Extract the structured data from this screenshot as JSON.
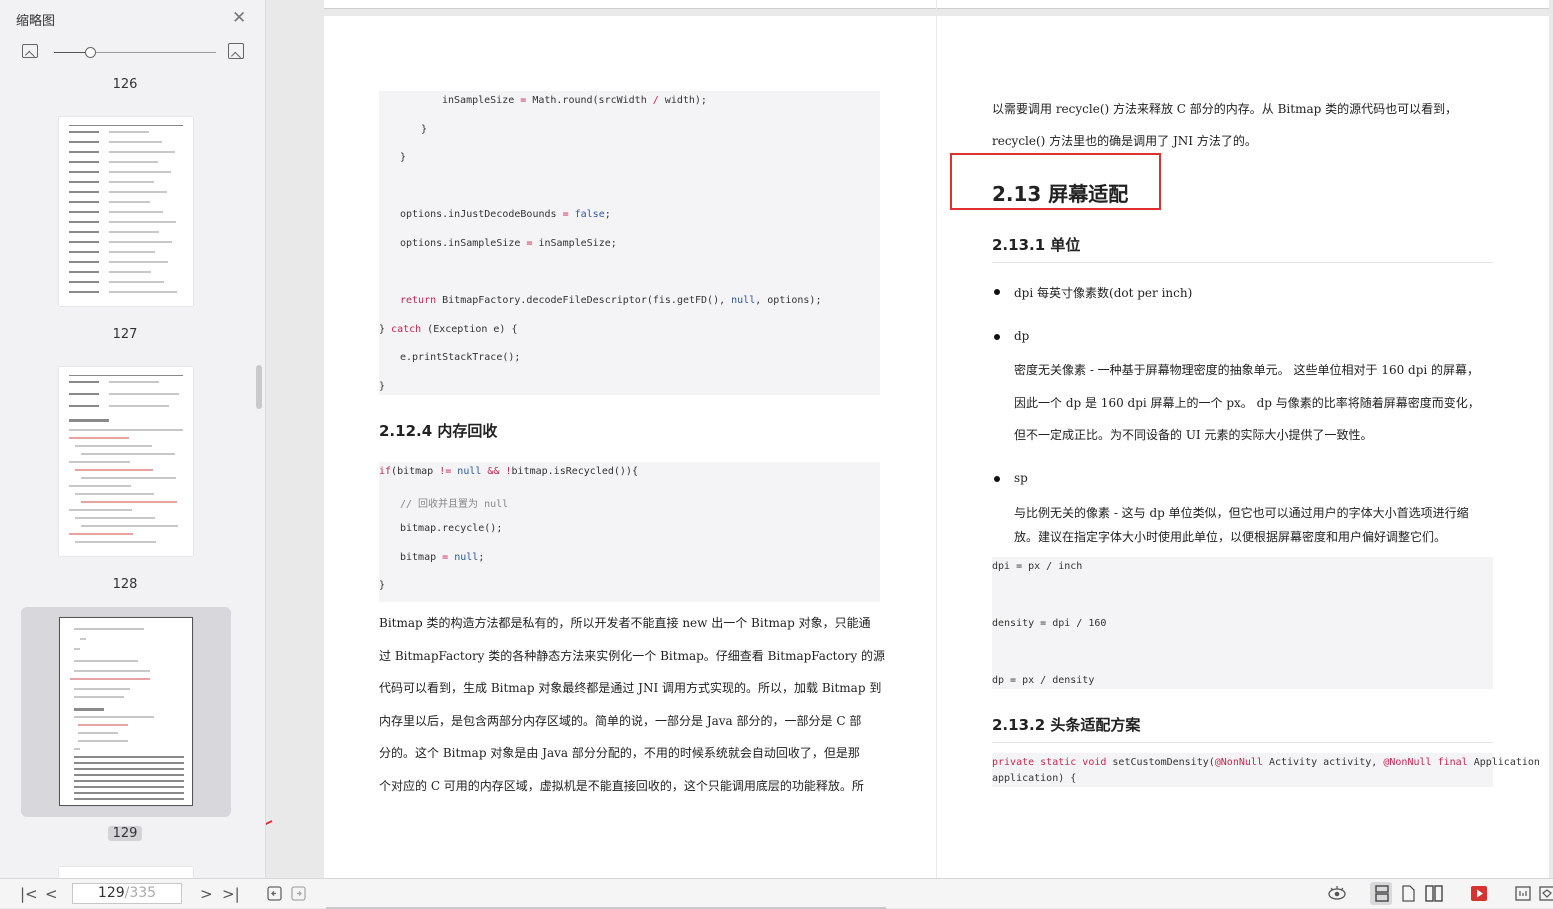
{
  "sidebar": {
    "title": "缩略图",
    "close_icon": "close-icon",
    "zoom": {
      "value_fraction": 0.23
    },
    "page_labels": [
      "126",
      "127",
      "128",
      "129"
    ],
    "selected_page": "129"
  },
  "left_page": {
    "code_top": [
      {
        "indent": 3,
        "parts": [
          {
            "t": "inSampleSize "
          },
          {
            "t": "=",
            "c": "kw"
          },
          {
            "t": " Math.round(srcWidth "
          },
          {
            "t": "/",
            "c": "kw"
          },
          {
            "t": " width);"
          }
        ]
      },
      {
        "indent": 2,
        "parts": [
          {
            "t": "}"
          }
        ]
      },
      {
        "indent": 1,
        "parts": [
          {
            "t": "}"
          }
        ]
      },
      {
        "indent": 1,
        "parts": [
          {
            "t": ""
          }
        ]
      },
      {
        "indent": 1,
        "parts": [
          {
            "t": "options.inJustDecodeBounds "
          },
          {
            "t": "=",
            "c": "kw"
          },
          {
            "t": " "
          },
          {
            "t": "false",
            "c": "bl"
          },
          {
            "t": ";"
          }
        ]
      },
      {
        "indent": 1,
        "parts": [
          {
            "t": "options.inSampleSize "
          },
          {
            "t": "=",
            "c": "kw"
          },
          {
            "t": " inSampleSize;"
          }
        ]
      },
      {
        "indent": 1,
        "parts": [
          {
            "t": ""
          }
        ]
      },
      {
        "indent": 1,
        "parts": [
          {
            "t": "return",
            "c": "kw"
          },
          {
            "t": " BitmapFactory.decodeFileDescriptor(fis.getFD(), "
          },
          {
            "t": "null",
            "c": "bl"
          },
          {
            "t": ", options);"
          }
        ]
      },
      {
        "indent": 0,
        "parts": [
          {
            "t": "} "
          },
          {
            "t": "catch",
            "c": "kw"
          },
          {
            "t": " (Exception e) {"
          }
        ]
      },
      {
        "indent": 1,
        "parts": [
          {
            "t": "e.printStackTrace();"
          }
        ]
      },
      {
        "indent": 0,
        "parts": [
          {
            "t": "}"
          }
        ]
      }
    ],
    "heading": "2.12.4  内存回收",
    "code_recycle": [
      {
        "indent": 0,
        "parts": [
          {
            "t": "if",
            "c": "kw"
          },
          {
            "t": "(bitmap "
          },
          {
            "t": "!=",
            "c": "kw"
          },
          {
            "t": " "
          },
          {
            "t": "null",
            "c": "bl"
          },
          {
            "t": " "
          },
          {
            "t": "&&",
            "c": "kw"
          },
          {
            "t": " "
          },
          {
            "t": "!",
            "c": "kw"
          },
          {
            "t": "bitmap.isRecycled()){"
          }
        ]
      },
      {
        "indent": 1,
        "parts": [
          {
            "t": "// 回收并且置为 null",
            "c": "cm"
          }
        ]
      },
      {
        "indent": 1,
        "parts": [
          {
            "t": "bitmap.recycle();"
          }
        ]
      },
      {
        "indent": 1,
        "parts": [
          {
            "t": "bitmap "
          },
          {
            "t": "=",
            "c": "kw"
          },
          {
            "t": " "
          },
          {
            "t": "null",
            "c": "bl"
          },
          {
            "t": ";"
          }
        ]
      },
      {
        "indent": 0,
        "parts": [
          {
            "t": "}"
          }
        ]
      }
    ],
    "paragraph_lines": [
      "Bitmap  类的构造方法都是私有的，所以开发者不能直接  new  出一个  Bitmap  对象，只能通",
      "过  BitmapFactory  类的各种静态方法来实例化一个  Bitmap。仔细查看  BitmapFactory  的源",
      "代码可以看到，生成  Bitmap  对象最终都是通过  JNI  调用方式实现的。所以，加载  Bitmap  到",
      "内存里以后，是包含两部分内存区域的。简单的说，一部分是 Java  部分的，一部分是  C  部",
      "分的。这个  Bitmap  对象是由  Java  部分分配的，不用的时候系统就会自动回收了，但是那",
      "个对应的  C  可用的内存区域，虚拟机是不能直接回收的，这个只能调用底层的功能释放。所"
    ]
  },
  "right_page": {
    "intro_lines": [
      "以需要调用  recycle()  方法来释放  C  部分的内存。从  Bitmap  类的源代码也可以看到，",
      "recycle()  方法里也的确是调用了  JNI  方法了的。"
    ],
    "section_heading": "2.13  屏幕适配",
    "sub_heading_1": "2.13.1  单位",
    "bullets": [
      {
        "term": "dpi  每英寸像素数(dot per inch)",
        "desc": []
      },
      {
        "term": "dp",
        "desc": [
          "密度无关像素 - 一种基于屏幕物理密度的抽象单元。 这些单位相对于  160 dpi  的屏幕，",
          "因此一个  dp  是  160 dpi  屏幕上的一个  px。 dp  与像素的比率将随着屏幕密度而变化，",
          "但不一定成正比。为不同设备的  UI  元素的实际大小提供了一致性。"
        ]
      },
      {
        "term": "sp",
        "desc": [
          "与比例无关的像素 - 这与  dp  单位类似，但它也可以通过用户的字体大小首选项进行缩",
          "放。建议在指定字体大小时使用此单位，以便根据屏幕密度和用户偏好调整它们。"
        ]
      }
    ],
    "formula_lines": [
      "dpi = px / inch",
      "density = dpi / 160",
      "dp = px / density"
    ],
    "sub_heading_2": "2.13.2  头条适配方案",
    "code_bottom": [
      {
        "parts": [
          {
            "t": "private static void",
            "c": "kw"
          },
          {
            "t": " setCustomDensity("
          },
          {
            "t": "@NonNull",
            "c": "an"
          },
          {
            "t": " Activity activity, "
          },
          {
            "t": "@NonNull",
            "c": "an"
          },
          {
            "t": " "
          },
          {
            "t": "final",
            "c": "kw"
          },
          {
            "t": " Application"
          }
        ]
      },
      {
        "parts": [
          {
            "t": "application) {"
          }
        ]
      }
    ]
  },
  "statusbar": {
    "current_page": "129",
    "total_pages": "/335",
    "icons": [
      "first-page-icon",
      "prev-page-icon",
      "next-page-icon",
      "last-page-icon",
      "back-icon",
      "forward-icon",
      "eye-icon",
      "continuous-view-icon",
      "single-page-icon",
      "two-page-icon",
      "play-icon",
      "fit-icon",
      "fullscreen-icon"
    ]
  },
  "colors": {
    "accent_red": "#e03030",
    "code_keyword": "#c7254e"
  }
}
